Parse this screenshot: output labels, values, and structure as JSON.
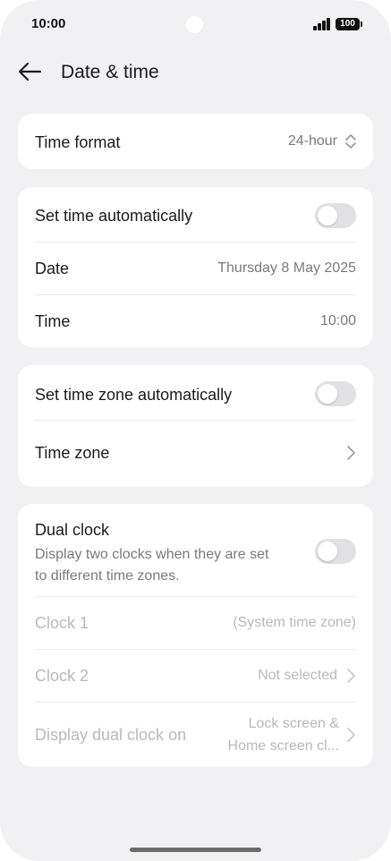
{
  "status_bar": {
    "time": "10:00",
    "battery": "100"
  },
  "header": {
    "title": "Date & time"
  },
  "time_format": {
    "label": "Time format",
    "value": "24-hour"
  },
  "auto_time": {
    "set_time_label": "Set time automatically",
    "set_time_enabled": false,
    "date_label": "Date",
    "date_value": "Thursday 8 May 2025",
    "time_label": "Time",
    "time_value": "10:00"
  },
  "time_zone": {
    "auto_label": "Set time zone automatically",
    "auto_enabled": false,
    "zone_label": "Time zone"
  },
  "dual_clock": {
    "title": "Dual clock",
    "description_line1": "Display two clocks when they are set",
    "description_line2": "to different time zones.",
    "enabled": false,
    "clock1_label": "Clock 1",
    "clock1_value": "(System time zone)",
    "clock2_label": "Clock 2",
    "clock2_value": "Not selected",
    "display_on_label": "Display dual clock on",
    "display_on_value_line1": "Lock screen &",
    "display_on_value_line2": "Home screen cl..."
  },
  "colors": {
    "background": "#f1f1f3",
    "card": "#ffffff",
    "toggle_off": "#e1e1e4",
    "disabled_text": "#b9b9bd"
  }
}
